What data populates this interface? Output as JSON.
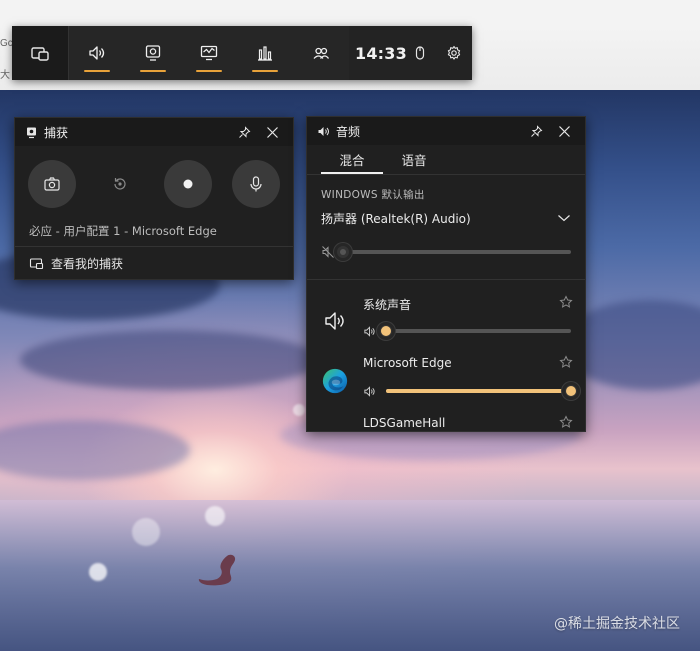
{
  "browser": {
    "fragment_top": "Gc",
    "fragment_left": "大"
  },
  "topbar": {
    "widget_menu_icon": "widget-menu-icon",
    "buttons": [
      {
        "name": "audio",
        "icon": "speaker-icon",
        "active": true
      },
      {
        "name": "capture",
        "icon": "capture-icon",
        "active": true
      },
      {
        "name": "performance",
        "icon": "performance-icon",
        "active": true
      },
      {
        "name": "resources",
        "icon": "bar-chart-icon",
        "active": true
      },
      {
        "name": "social",
        "icon": "people-icon",
        "active": false
      }
    ],
    "time": "14:33",
    "mouse_icon": "mouse-icon",
    "settings_icon": "gear-icon",
    "accent_color": "#e8a23a"
  },
  "capture": {
    "title": "捕获",
    "status": "必应 - 用户配置 1 - Microsoft Edge",
    "show_captures": "查看我的捕获"
  },
  "audio": {
    "title": "音频",
    "tabs": [
      {
        "label": "混合",
        "active": true
      },
      {
        "label": "语音",
        "active": false
      }
    ],
    "output_label": "WINDOWS 默认输出",
    "device_name": "扬声器 (Realtek(R) Audio)",
    "master_volume": 0,
    "master_muted": true,
    "apps": [
      {
        "name": "系统声音",
        "volume": 0.0
      },
      {
        "name": "Microsoft Edge",
        "volume": 1.0
      },
      {
        "name": "LDSGameHall",
        "volume": null
      }
    ]
  },
  "watermark": "@稀土掘金技术社区"
}
